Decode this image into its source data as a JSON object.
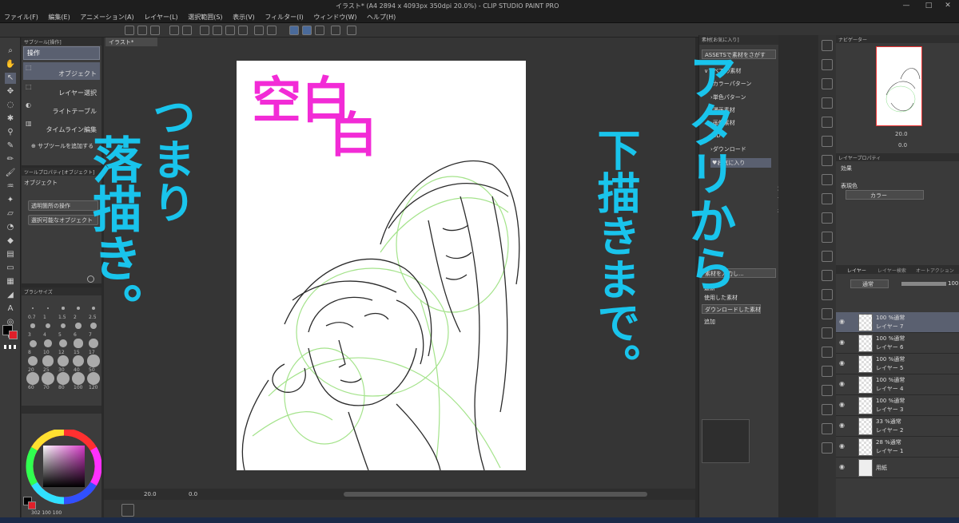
{
  "window": {
    "title": "イラスト* (A4 2894 x 4093px 350dpi 20.0%) - CLIP STUDIO PAINT PRO",
    "controls": [
      "—",
      "□",
      "✕"
    ]
  },
  "menu": [
    "ファイル(F)",
    "編集(E)",
    "アニメーション(A)",
    "レイヤー(L)",
    "選択範囲(S)",
    "表示(V)",
    "フィルター(I)",
    "ウィンドウ(W)",
    "ヘルプ(H)"
  ],
  "subtool_panel": {
    "header": "サブツール[操作]",
    "group_button": "操作",
    "items": [
      "オブジェクト",
      "レイヤー選択",
      "ライトテーブル",
      "タイムライン編集"
    ],
    "add_label": "サブツールを追加する"
  },
  "tool_property": {
    "header": "ツールプロパティ[オブジェクト]",
    "title": "オブジェクト",
    "transparent_op": "透明箇所の操作",
    "selectable": "選択可能なオブジェクト"
  },
  "brush_size": {
    "header": "ブラシサイズ",
    "sizes": [
      "0.7",
      "1",
      "1.5",
      "2",
      "2.5",
      "3",
      "4",
      "5",
      "6",
      "7",
      "8",
      "10",
      "12",
      "15",
      "17",
      "20",
      "25",
      "30",
      "40",
      "50",
      "60",
      "70",
      "80",
      "100",
      "120"
    ]
  },
  "color_panel": {
    "readout": "302  100  100"
  },
  "document": {
    "tab": "イラスト*",
    "zoom": "20.0",
    "rotation": "0.0"
  },
  "materials": {
    "header": "素材[お気に入り]",
    "search": "ASSETSで素材をさがす",
    "tree": [
      "すべての素材",
      "カラーパターン",
      "単色パターン",
      "漫画素材",
      "画像素材",
      "3D",
      "ダウンロード",
      "お気に入り"
    ],
    "tree_prefix": {
      "すべての素材": "∨",
      "カラーパターン": "›",
      "単色パターン": "›",
      "漫画素材": "›",
      "画像素材": "›",
      "3D": "›",
      "ダウンロード": "›",
      "お気に入り": "♥"
    },
    "hint_lines": [
      "素材をお気に",
      "入り登録する",
      "とここに表示さ",
      "れます",
      "※お気に",
      "入り登録",
      "/解除は",
      "、お気に",
      "入りボタ",
      "ン(♥)から",
      "行えます"
    ],
    "tag_input": "素材を入力し...",
    "tag_list": [
      "最新",
      "使用した素材",
      "ダウンロードした素材",
      "追加"
    ]
  },
  "navigator": {
    "header": "ナビゲーター",
    "zoom": "20.0",
    "angle": "0.0"
  },
  "layer_property": {
    "header": "レイヤープロパティ",
    "effect_label": "効果",
    "expression_label": "表現色",
    "expression_value": "カラー"
  },
  "layers": {
    "tabs": [
      "レイヤー",
      "レイヤー検索",
      "オートアクション"
    ],
    "blend_mode": "通常",
    "opacity": "100",
    "rows": [
      {
        "top": "100 %通常",
        "name": "レイヤー 7"
      },
      {
        "top": "100 %通常",
        "name": "レイヤー 6"
      },
      {
        "top": "100 %通常",
        "name": "レイヤー 5"
      },
      {
        "top": "100 %通常",
        "name": "レイヤー 4"
      },
      {
        "top": "100 %通常",
        "name": "レイヤー 3"
      },
      {
        "top": "33 %通常",
        "name": "レイヤー 2"
      },
      {
        "top": "28 %通常",
        "name": "レイヤー 1"
      },
      {
        "top": "",
        "name": "用紙"
      }
    ]
  },
  "annotations": {
    "left_column": [
      "つまり",
      "落描き。"
    ],
    "magenta_1": "空白",
    "magenta_2": "白",
    "right_column_1": "アタリから",
    "right_column_2": "下描きまで。"
  },
  "colors": {
    "cyan": "#19c4ec",
    "magenta": "#f22bd6",
    "panel": "#3a3a3a",
    "canvas_bg": "#353535",
    "selected": "#5a6070"
  }
}
